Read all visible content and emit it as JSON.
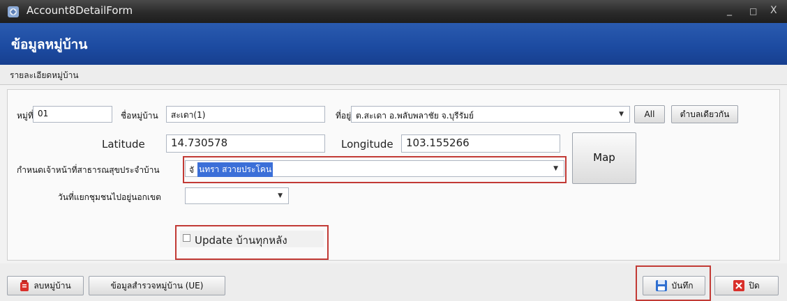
{
  "window": {
    "title": "Account8DetailForm",
    "minimize": "_",
    "maximize": "□",
    "close": "X"
  },
  "header": {
    "title": "ข้อมูลหมู่บ้าน"
  },
  "subheader": {
    "title": "รายละเอียดหมู่บ้าน"
  },
  "form": {
    "moo_label": "หมู่ที่",
    "moo_value": "01",
    "village_name_label": "ชื่อหมู่บ้าน",
    "village_name_value": "สะเดา(1)",
    "address_label": "ที่อยู่",
    "address_value": "ต.สะเดา อ.พลับพลาชัย จ.บุรีรัมย์",
    "all_button": "All",
    "same_subdistrict_button": "ตำบลเดียวกัน",
    "latitude_label": "Latitude",
    "latitude_value": "14.730578",
    "longitude_label": "Longitude",
    "longitude_value": "103.155266",
    "map_button": "Map",
    "officer_label": "กำหนดเจ้าหน้าที่สาธารณสุขประจำบ้าน",
    "officer_value_prefix": "จั",
    "officer_value_selected": "นทรา สวายประโคน",
    "separate_date_label": "วันที่แยกชุมชนไปอยู่นอกเขต",
    "separate_date_value": "",
    "update_checkbox_label": "Update บ้านทุกหลัง",
    "update_checked": false
  },
  "footer": {
    "delete_button": "ลบหมู่บ้าน",
    "survey_button": "ข้อมูลสำรวจหมู่บ้าน (UE)",
    "save_button": "บันทึก",
    "close_button": "ปิด"
  },
  "colors": {
    "header": "#1c4aa0",
    "highlight": "#c23a35",
    "selection": "#3b6fd8"
  }
}
